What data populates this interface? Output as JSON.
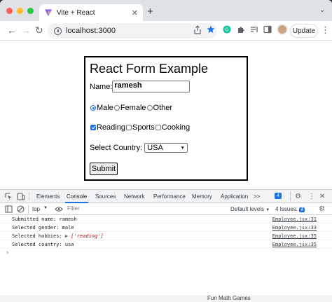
{
  "tab": {
    "title": "Vite + React",
    "close": "✕",
    "new_tab": "+",
    "menu": "⌄"
  },
  "toolbar": {
    "url": "localhost:3000",
    "update_label": "Update",
    "back": "←",
    "forward": "→",
    "reload": "↻",
    "kebab": "⋮"
  },
  "form": {
    "title": "React Form Example",
    "name_label": "Name:",
    "name_value": "ramesh",
    "gender_options": [
      "Male",
      "Female",
      "Other"
    ],
    "gender_selected": "Male",
    "hobbies": [
      "Reading",
      "Sports",
      "Cooking"
    ],
    "hobbies_checked": [
      "Reading"
    ],
    "country_label": "Select Country:",
    "country_value": "USA",
    "submit_label": "Submit"
  },
  "devtools": {
    "tabs": [
      "Elements",
      "Console",
      "Sources",
      "Network",
      "Performance",
      "Memory",
      "Application"
    ],
    "active_tab": "Console",
    "more": ">>",
    "issues_count": "4",
    "context": "top",
    "filter_placeholder": "Filter",
    "levels": "Default levels",
    "issues_label": "4 Issues:",
    "issues_mini": "4",
    "logs": [
      {
        "text": "Submitted name: ramesh",
        "source": "Employee.jsx:31"
      },
      {
        "text": "Selected gender: male",
        "source": "Employee.jsx:33"
      },
      {
        "prefix": "Selected hobbies: ",
        "arrow": "▶",
        "value": "['reading']",
        "source": "Employee.jsx:35"
      },
      {
        "text": "Selected country: usa",
        "source": "Employee.jsx:35"
      }
    ],
    "prompt": "›",
    "bottom_hint": "Fun Math Games"
  },
  "colors": {
    "accent": "#1a73e8",
    "string_red": "#c80000"
  }
}
